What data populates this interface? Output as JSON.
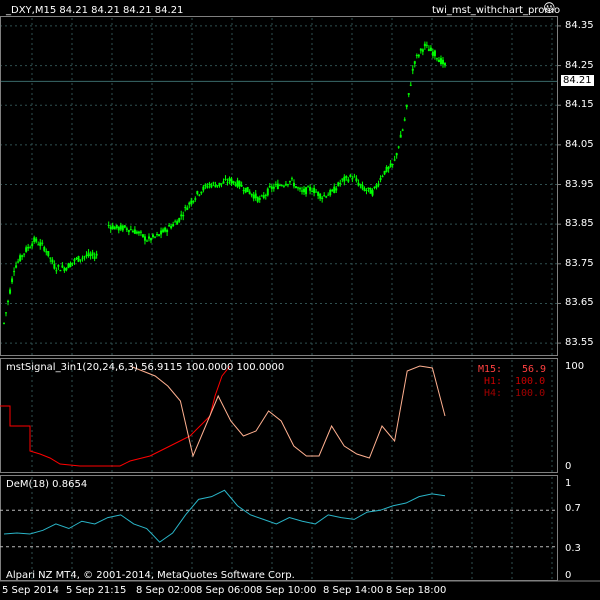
{
  "header": {
    "symbol_info": "_DXY,M15  84.21 84.21 84.21 84.21",
    "expert_name": "twi_mst_withchart_promo",
    "expert_icon": "smiley-icon"
  },
  "price_panel": {
    "ticks": [
      "84.35",
      "84.25",
      "84.15",
      "84.05",
      "83.95",
      "83.85",
      "83.75",
      "83.65",
      "83.55"
    ],
    "tick_values": [
      84.35,
      84.25,
      84.15,
      84.05,
      83.95,
      83.85,
      83.75,
      83.65,
      83.55
    ],
    "current_price": "84.21",
    "current_value": 84.21,
    "ylim": [
      83.52,
      84.37
    ]
  },
  "signal_panel": {
    "title": "mstSignal_3in1(20,24,6,3) 56.9115 100.0000 100.0000",
    "ticks": [
      "100",
      "0"
    ],
    "legend": [
      {
        "label": "M15:",
        "value": "56.9",
        "color": "#FF4040"
      },
      {
        "label": "H1:",
        "value": "100.0",
        "color": "#C80000"
      },
      {
        "label": "H4:",
        "value": "100.0",
        "color": "#A00000"
      }
    ]
  },
  "dem_panel": {
    "title": "DeM(18) 0.8654",
    "ticks": [
      "1",
      "0.7",
      "0.3",
      "0"
    ],
    "levels": [
      0.7,
      0.3
    ]
  },
  "time_axis": {
    "labels": [
      "5 Sep 2014",
      "5 Sep 21:15",
      "8 Sep 02:00",
      "8 Sep 06:00",
      "8 Sep 10:00",
      "8 Sep 14:00",
      "8 Sep 18:00"
    ]
  },
  "footer": {
    "copyright": "Alpari NZ MT4, © 2001-2014, MetaQuotes Software Corp."
  },
  "colors": {
    "background": "#000000",
    "grid": "#2F4F4F",
    "candle": "#00FF00",
    "signal_line": "#FFB090",
    "signal_red": "#FF0000",
    "dem_line": "#2AB5C8"
  },
  "chart_data": {
    "type": "line",
    "price_path": [
      83.6,
      83.74,
      83.78,
      83.81,
      83.79,
      83.74,
      83.74,
      83.76,
      83.77,
      83.77,
      83.85,
      83.84,
      83.84,
      83.83,
      83.81,
      83.82,
      83.84,
      83.86,
      83.9,
      83.93,
      83.95,
      83.95,
      83.96,
      83.95,
      83.93,
      83.91,
      83.94,
      83.95,
      83.96,
      83.93,
      83.94,
      83.92,
      83.93,
      83.96,
      83.97,
      83.94,
      83.93,
      83.98,
      84.0,
      84.1,
      84.26,
      84.3,
      84.28,
      84.25
    ],
    "signal_m15": [
      100,
      95,
      90,
      80,
      65,
      10,
      40,
      70,
      45,
      30,
      35,
      55,
      45,
      20,
      10,
      10,
      40,
      20,
      12,
      8,
      40,
      25,
      95,
      100,
      98,
      50
    ],
    "dem": [
      0.44,
      0.45,
      0.44,
      0.48,
      0.55,
      0.5,
      0.58,
      0.55,
      0.62,
      0.65,
      0.55,
      0.5,
      0.35,
      0.45,
      0.65,
      0.82,
      0.85,
      0.92,
      0.75,
      0.65,
      0.6,
      0.55,
      0.62,
      0.58,
      0.55,
      0.65,
      0.62,
      0.6,
      0.68,
      0.7,
      0.75,
      0.78,
      0.85,
      0.88,
      0.86
    ]
  }
}
